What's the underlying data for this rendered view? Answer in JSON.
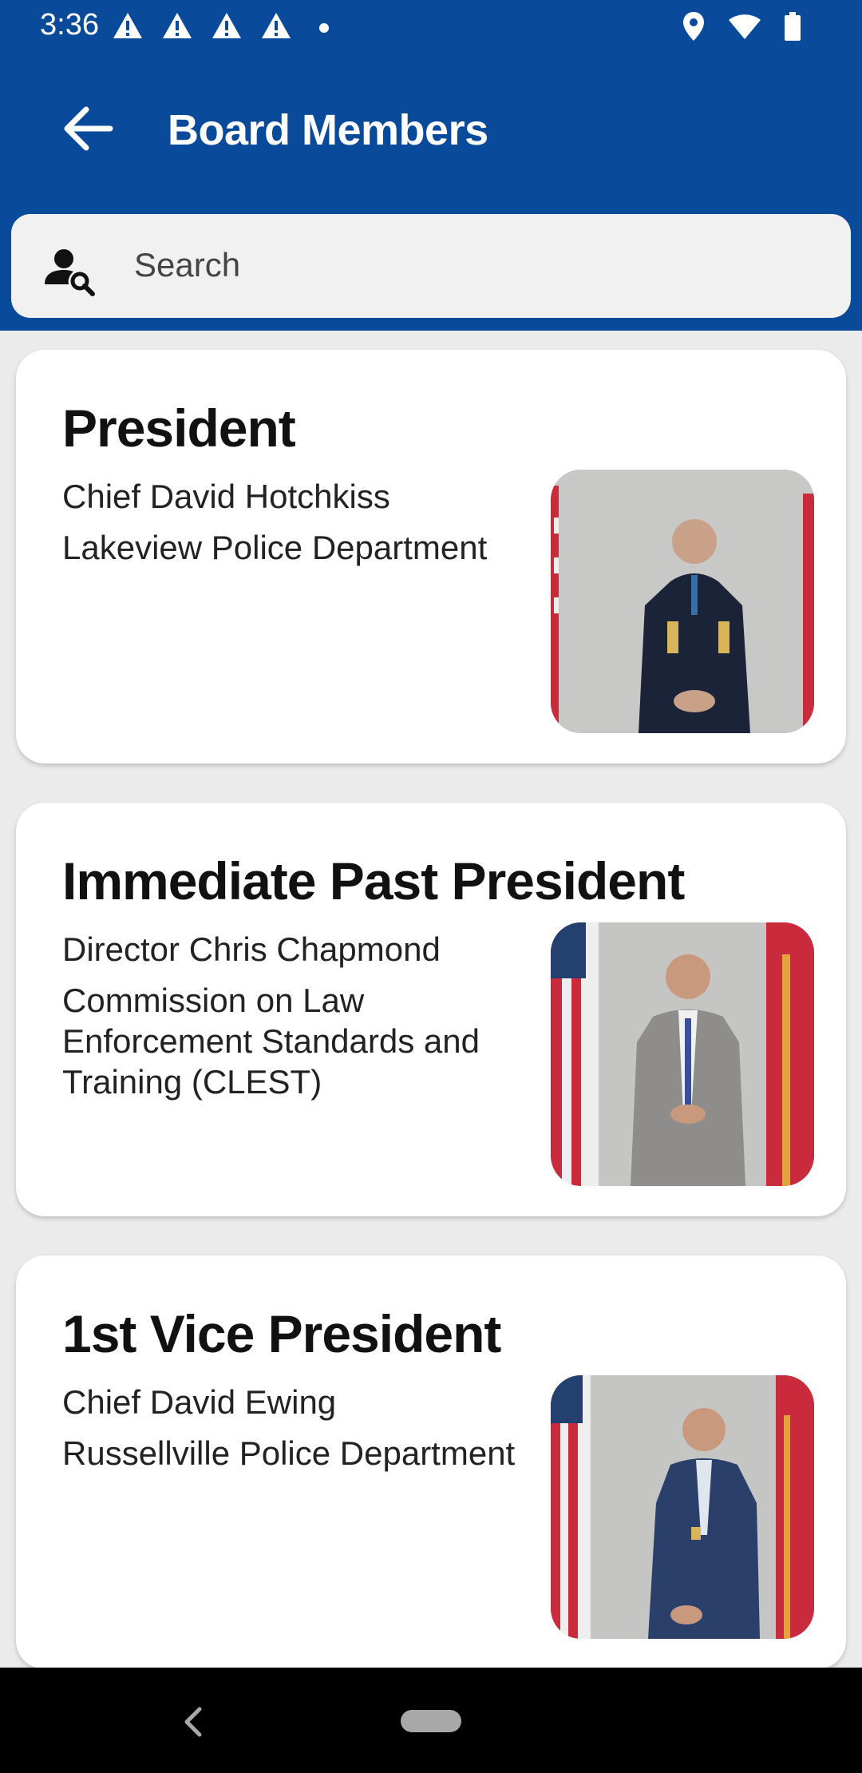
{
  "status_bar": {
    "time": "3:36",
    "icons": [
      "warning-icon",
      "warning-icon",
      "warning-icon",
      "warning-icon",
      "notification-dot",
      "location-icon",
      "wifi-icon",
      "battery-icon"
    ]
  },
  "app_bar": {
    "title": "Board Members",
    "back_icon": "arrow-back-icon",
    "color": "#0a4a9b"
  },
  "search": {
    "placeholder": "Search",
    "icon": "person-search-icon"
  },
  "members": [
    {
      "position": "President",
      "name": "Chief David Hotchkiss",
      "department": "Lakeview Police Department"
    },
    {
      "position": "Immediate Past President",
      "name": "Director Chris Chapmond",
      "department": "Commission on Law Enforcement Standards and Training (CLEST)"
    },
    {
      "position": "1st Vice President",
      "name": "Chief David Ewing",
      "department": "Russellville Police Department"
    }
  ],
  "nav_bar": {
    "back_icon": "nav-back-icon",
    "home_icon": "nav-home-pill"
  }
}
